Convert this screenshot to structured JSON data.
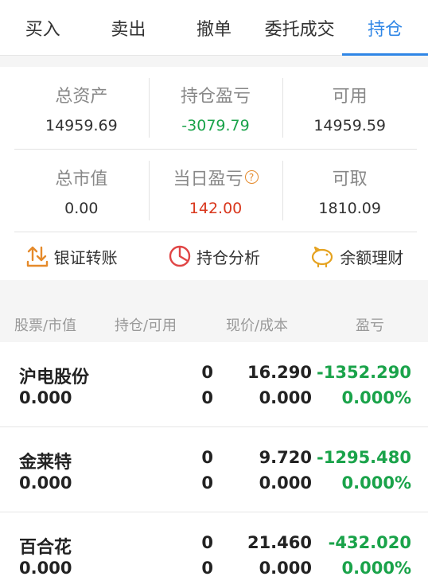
{
  "tabs": [
    {
      "label": "买入",
      "active": false
    },
    {
      "label": "卖出",
      "active": false
    },
    {
      "label": "撤单",
      "active": false
    },
    {
      "label": "委托成交",
      "active": false
    },
    {
      "label": "持仓",
      "active": true
    }
  ],
  "summary": {
    "total_assets": {
      "label": "总资产",
      "value": "14959.69"
    },
    "position_pl": {
      "label": "持仓盈亏",
      "value": "-3079.79"
    },
    "available": {
      "label": "可用",
      "value": "14959.59"
    },
    "market_value": {
      "label": "总市值",
      "value": "0.00"
    },
    "daily_pl": {
      "label": "当日盈亏",
      "value": "142.00"
    },
    "withdrawable": {
      "label": "可取",
      "value": "1810.09"
    }
  },
  "actions": {
    "bank_transfer": "银证转账",
    "position_analysis": "持仓分析",
    "balance_wealth": "余额理财"
  },
  "table": {
    "headers": [
      "股票/市值",
      "持仓/可用",
      "现价/成本",
      "盈亏"
    ],
    "rows": [
      {
        "name": "沪电股份",
        "market_value": "0.000",
        "holding": "0",
        "available": "0",
        "price": "16.290",
        "cost": "0.000",
        "pl": "-1352.290",
        "pl_pct": "0.000%"
      },
      {
        "name": "金莱特",
        "market_value": "0.000",
        "holding": "0",
        "available": "0",
        "price": "9.720",
        "cost": "0.000",
        "pl": "-1295.480",
        "pl_pct": "0.000%"
      },
      {
        "name": "百合花",
        "market_value": "0.000",
        "holding": "0",
        "available": "0",
        "price": "21.460",
        "cost": "0.000",
        "pl": "-432.020",
        "pl_pct": "0.000%"
      }
    ]
  },
  "colors": {
    "accent": "#2f86e6",
    "loss": "#1aa34a",
    "gain": "#d9381e",
    "icon_orange": "#e58a2b"
  }
}
